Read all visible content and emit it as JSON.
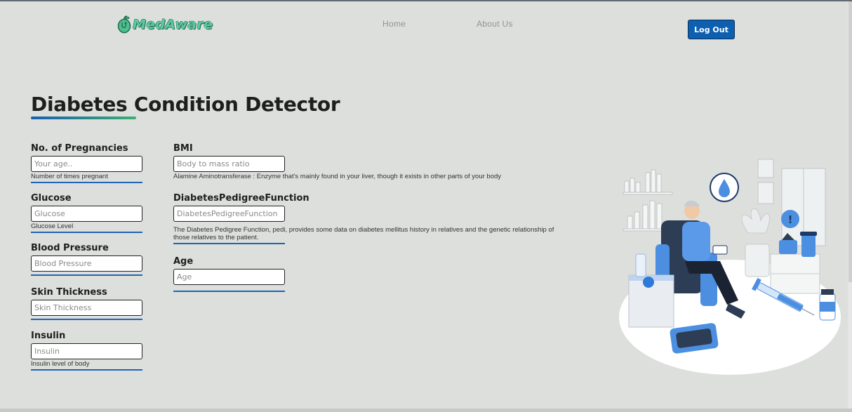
{
  "header": {
    "logo_text": "MedAware",
    "nav": {
      "home": "Home",
      "about": "About Us"
    },
    "logout_label": "Log Out"
  },
  "page": {
    "title": "Diabetes Condition Detector"
  },
  "fields": {
    "pregnancies": {
      "label": "No. of Pregnancies",
      "placeholder": "Your age..",
      "help": "Number of times pregnant"
    },
    "glucose": {
      "label": "Glucose",
      "placeholder": "Glucose",
      "help": "Glucose Level"
    },
    "blood_pressure": {
      "label": "Blood Pressure",
      "placeholder": "Blood Pressure"
    },
    "skin_thickness": {
      "label": "Skin Thickness",
      "placeholder": "Skin Thickness"
    },
    "insulin": {
      "label": "Insulin",
      "placeholder": "Insulin",
      "help": "Insulin level of body"
    },
    "bmi": {
      "label": "BMI",
      "placeholder": "Body to mass ratio",
      "help": "Alamine Aminotransferase : Enzyme that's mainly found in your liver, though it exists in other parts of your body"
    },
    "pedigree": {
      "label": "DiabetesPedigreeFunction",
      "placeholder": "DiabetesPedigreeFunction",
      "help": "The Diabetes Pedigree Function, pedi, provides some data on diabetes mellitus history in relatives and the genetic relationship of those relatives to the patient."
    },
    "age": {
      "label": "Age",
      "placeholder": "Age"
    }
  },
  "colors": {
    "accent": "#0d5fb0",
    "logo": "#5fc9a3",
    "background": "#dcdfdc"
  }
}
